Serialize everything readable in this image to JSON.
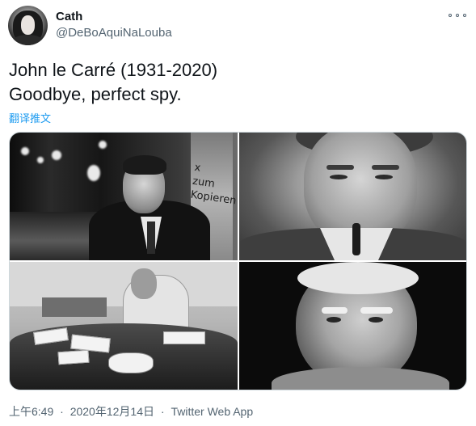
{
  "author": {
    "name": "Cath",
    "handle": "@DeBoAquiNaLouba",
    "avatar_icon": "profile-avatar"
  },
  "more_icon": "more-dots-icon",
  "tweet": {
    "line1": "John le Carré (1931-2020)",
    "line2": "Goodbye, perfect spy.",
    "translate_label": "翻译推文"
  },
  "media": {
    "photo1_sign": "x\nzum\nKopieren"
  },
  "meta": {
    "time": "上午6:49",
    "date": "2020年12月14日",
    "separator": "·",
    "source": "Twitter Web App"
  },
  "colors": {
    "link": "#1d9bf0",
    "secondary_text": "#536471",
    "primary_text": "#0f1419"
  }
}
